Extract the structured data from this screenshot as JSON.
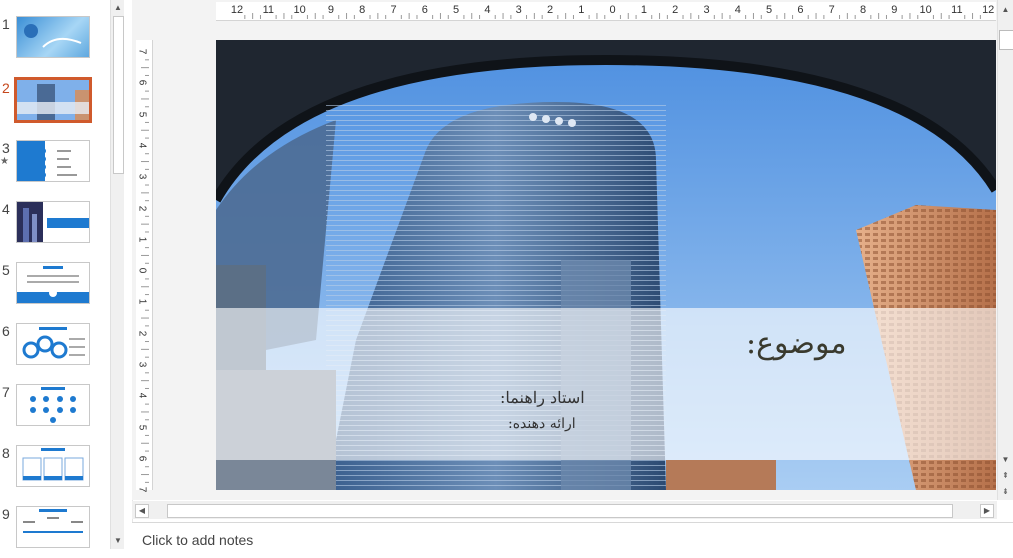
{
  "thumbnails": [
    {
      "number": "1",
      "selected": false,
      "star": ""
    },
    {
      "number": "2",
      "selected": true,
      "star": ""
    },
    {
      "number": "3",
      "selected": false,
      "star": "★"
    },
    {
      "number": "4",
      "selected": false,
      "star": ""
    },
    {
      "number": "5",
      "selected": false,
      "star": ""
    },
    {
      "number": "6",
      "selected": false,
      "star": ""
    },
    {
      "number": "7",
      "selected": false,
      "star": ""
    },
    {
      "number": "8",
      "selected": false,
      "star": ""
    },
    {
      "number": "9",
      "selected": false,
      "star": ""
    }
  ],
  "ruler": {
    "horizontal": [
      "12",
      "11",
      "10",
      "9",
      "8",
      "7",
      "6",
      "5",
      "4",
      "3",
      "2",
      "1",
      "0",
      "1",
      "2",
      "3",
      "4",
      "5",
      "6",
      "7",
      "8",
      "9",
      "10",
      "11",
      "12"
    ],
    "vertical": [
      "7",
      "6",
      "5",
      "4",
      "3",
      "2",
      "1",
      "0",
      "1",
      "2",
      "3",
      "4",
      "5",
      "6",
      "7"
    ]
  },
  "slide": {
    "title": "موضوع:",
    "line1": "استاد راهنما:",
    "line2": "ارائه دهنده:"
  },
  "notes": {
    "placeholder": "Click to add notes"
  },
  "colors": {
    "selected_border": "#d05a2c",
    "sky": "#6fa6e8"
  },
  "icons": {
    "scroll_up": "▲",
    "scroll_down": "▼",
    "scroll_left": "◀",
    "scroll_right": "▶",
    "prev_slide": "⇞",
    "next_slide": "⇟"
  }
}
